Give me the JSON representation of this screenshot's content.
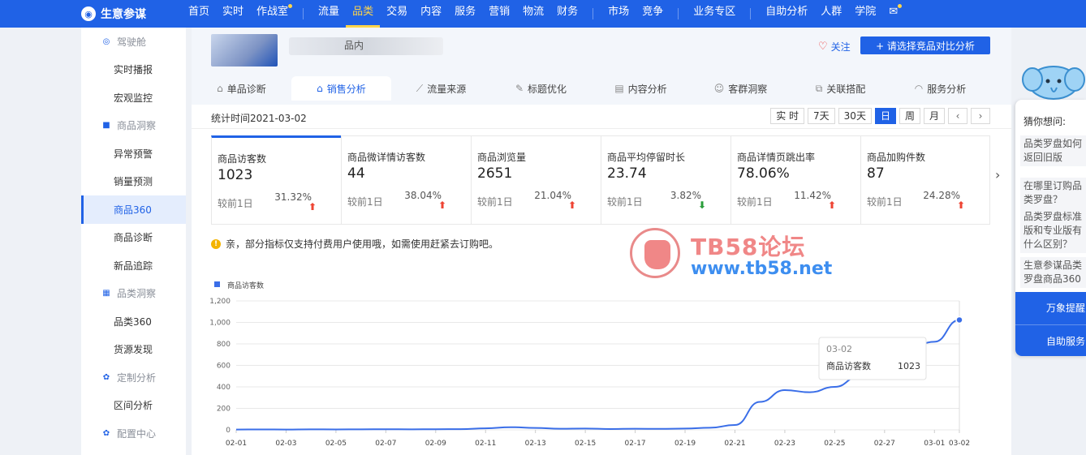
{
  "app": {
    "name": "生意参谋",
    "logo_icon": "logo-icon"
  },
  "nav": {
    "items": [
      {
        "label": "首页"
      },
      {
        "label": "实时"
      },
      {
        "label": "作战室",
        "dot": true
      },
      {
        "label": "流量",
        "sep_before": true
      },
      {
        "label": "品类",
        "active": true
      },
      {
        "label": "交易"
      },
      {
        "label": "内容"
      },
      {
        "label": "服务"
      },
      {
        "label": "营销"
      },
      {
        "label": "物流"
      },
      {
        "label": "财务"
      },
      {
        "label": "市场",
        "sep_before": true
      },
      {
        "label": "竞争"
      },
      {
        "label": "业务专区",
        "sep_before": true
      },
      {
        "label": "自助分析",
        "sep_before": true
      },
      {
        "label": "人群"
      },
      {
        "label": "学院"
      },
      {
        "label": "✉",
        "dot": true
      }
    ],
    "accent": "#2062e6",
    "active_color": "#ffd54a"
  },
  "sidebar": {
    "items": [
      {
        "label": "驾驶舱",
        "type": "group",
        "icon": "dashboard-icon"
      },
      {
        "label": "实时播报",
        "type": "sub"
      },
      {
        "label": "宏观监控",
        "type": "sub"
      },
      {
        "label": "商品洞察",
        "type": "group",
        "icon": "bag-icon"
      },
      {
        "label": "异常预警",
        "type": "sub"
      },
      {
        "label": "销量预测",
        "type": "sub"
      },
      {
        "label": "商品360",
        "type": "sub",
        "active": true
      },
      {
        "label": "商品诊断",
        "type": "sub"
      },
      {
        "label": "新品追踪",
        "type": "sub"
      },
      {
        "label": "品类洞察",
        "type": "group",
        "icon": "grid-icon"
      },
      {
        "label": "品类360",
        "type": "sub"
      },
      {
        "label": "货源发现",
        "type": "sub"
      },
      {
        "label": "定制分析",
        "type": "group",
        "icon": "gear-icon"
      },
      {
        "label": "区间分析",
        "type": "sub"
      },
      {
        "label": "配置中心",
        "type": "group",
        "icon": "gear-icon"
      }
    ]
  },
  "product": {
    "name_fragment": "品内",
    "follow_label": "关注",
    "compare_label": "+ 请选择竞品对比分析"
  },
  "tabs": [
    {
      "label": "单品诊断",
      "icon": "home-icon"
    },
    {
      "label": "销售分析",
      "icon": "home-icon",
      "active": true
    },
    {
      "label": "流量来源",
      "icon": "line-chart-icon"
    },
    {
      "label": "标题优化",
      "icon": "pencil-icon"
    },
    {
      "label": "内容分析",
      "icon": "document-icon"
    },
    {
      "label": "客群洞察",
      "icon": "people-icon"
    },
    {
      "label": "关联搭配",
      "icon": "link-icon"
    },
    {
      "label": "服务分析",
      "icon": "headset-icon"
    }
  ],
  "datebar": {
    "stat_time": "统计时间2021-03-02",
    "periods": [
      {
        "label": "实 时"
      },
      {
        "label": "7天"
      },
      {
        "label": "30天"
      },
      {
        "label": "日",
        "active": true
      },
      {
        "label": "周"
      },
      {
        "label": "月"
      },
      {
        "label": "‹",
        "arrow": true
      },
      {
        "label": "›",
        "arrow": true
      }
    ]
  },
  "metrics": [
    {
      "label": "商品访客数",
      "value": "1023",
      "compare": "较前1日",
      "pct": "31.32%",
      "trend": "up",
      "active": true
    },
    {
      "label": "商品微详情访客数",
      "value": "44",
      "compare": "较前1日",
      "pct": "38.04%",
      "trend": "up"
    },
    {
      "label": "商品浏览量",
      "value": "2651",
      "compare": "较前1日",
      "pct": "21.04%",
      "trend": "up"
    },
    {
      "label": "商品平均停留时长",
      "value": "23.74",
      "compare": "较前1日",
      "pct": "3.82%",
      "trend": "down"
    },
    {
      "label": "商品详情页跳出率",
      "value": "78.06%",
      "compare": "较前1日",
      "pct": "11.42%",
      "trend": "up"
    },
    {
      "label": "商品加购件数",
      "value": "87",
      "compare": "较前1日",
      "pct": "24.28%",
      "trend": "up"
    }
  ],
  "metrics_next": "›",
  "notice": {
    "text": "亲，部分指标仅支持付费用户使用哦，如需使用赶紧去订购吧。"
  },
  "chart_data": {
    "type": "line",
    "x": [
      "02-01",
      "02-02",
      "02-03",
      "02-04",
      "02-05",
      "02-06",
      "02-07",
      "02-08",
      "02-09",
      "02-10",
      "02-11",
      "02-12",
      "02-13",
      "02-14",
      "02-15",
      "02-16",
      "02-17",
      "02-18",
      "02-19",
      "02-20",
      "02-21",
      "02-22",
      "02-23",
      "02-24",
      "02-25",
      "02-26",
      "02-27",
      "02-28",
      "03-01",
      "03-02"
    ],
    "xticks": [
      "02-01",
      "02-03",
      "02-05",
      "02-07",
      "02-09",
      "02-11",
      "02-13",
      "02-15",
      "02-17",
      "02-19",
      "02-21",
      "02-23",
      "02-25",
      "02-27",
      "03-01",
      "03-02"
    ],
    "series": [
      {
        "name": "商品访客数",
        "color": "#3a6ee8",
        "values": [
          3,
          4,
          3,
          5,
          4,
          5,
          6,
          5,
          6,
          7,
          14,
          25,
          18,
          10,
          12,
          8,
          10,
          9,
          12,
          20,
          45,
          260,
          370,
          350,
          400,
          500,
          620,
          760,
          820,
          1023
        ]
      }
    ],
    "ylim": [
      0,
      1200
    ],
    "yticks": [
      "0",
      "200",
      "400",
      "600",
      "800",
      "1,000",
      "1,200"
    ],
    "grid": true,
    "legend": "top-left",
    "tooltip": {
      "title": "03-02",
      "label": "商品访客数",
      "value": "1023"
    }
  },
  "watermark": {
    "title": "TB58论坛",
    "url": "www.tb58.net"
  },
  "assistant": {
    "title": "猜你想问:",
    "questions": [
      "品类罗盘如何返回旧版",
      "在哪里订购品类罗盘？",
      "品类罗盘标准版和专业版有什么区别？",
      "生意参谋品类罗盘商品360"
    ],
    "btn1": "万象提醒",
    "btn2": "自助服务"
  }
}
